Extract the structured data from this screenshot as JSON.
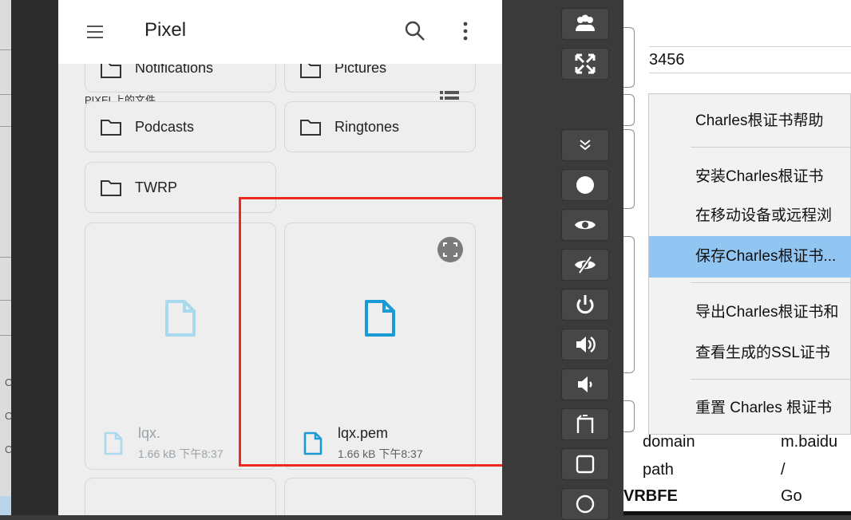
{
  "left_desktop": {
    "ticks": [
      "C",
      "C",
      "C"
    ]
  },
  "phone": {
    "appbar": {
      "title": "Pixel",
      "menu_icon": "hamburger-menu-icon",
      "search_icon": "search-icon",
      "more_icon": "more-vert-icon"
    },
    "partial_folders": [
      "Notifications",
      "Pictures"
    ],
    "section_label": "PIXEL上的文件",
    "folders": [
      "Podcasts",
      "Ringtones",
      "TWRP"
    ],
    "files": [
      {
        "name": "lqx.",
        "size": "1.66 kB",
        "time": "下午8:37",
        "state": "faded"
      },
      {
        "name": "lqx.pem",
        "size": "1.66 kB",
        "time": "下午8:37",
        "state": "normal"
      }
    ],
    "accent_color": "#1a9ad6",
    "highlight_color": "#ee2a1e"
  },
  "toolbar": {
    "buttons": [
      "users-icon",
      "fullscreen-icon",
      "chevron-double-down-icon",
      "record-icon",
      "eye-icon",
      "eye-off-icon",
      "power-icon",
      "volume-up-icon",
      "volume-down-icon",
      "rotate-icon",
      "square-icon",
      "circle-icon"
    ]
  },
  "charles": {
    "host_value": "3456",
    "menu": {
      "items": [
        "Charles根证书帮助",
        "安装Charles根证书",
        "在移动设备或远程浏",
        "保存Charles根证书...",
        "导出Charles根证书和",
        "查看生成的SSL证书",
        "重置 Charles 根证书"
      ],
      "highlighted_index": 3
    },
    "properties": [
      {
        "key": "domain",
        "value": "m.baidu"
      },
      {
        "key": "path",
        "value": "/"
      },
      {
        "key": "VRBFE",
        "value": "Go"
      }
    ]
  }
}
